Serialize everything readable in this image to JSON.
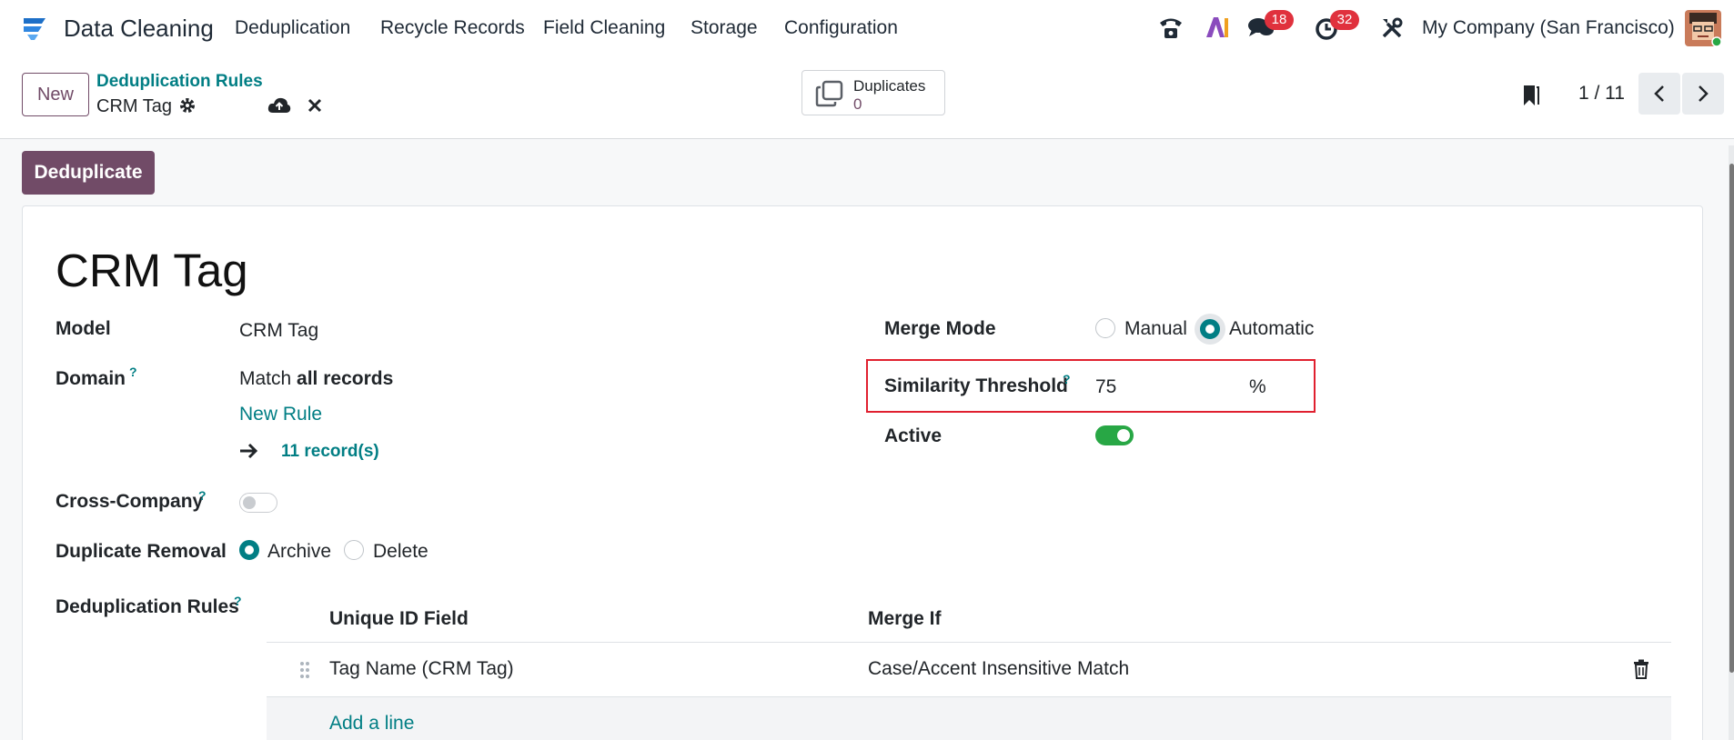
{
  "app": {
    "title": "Data Cleaning",
    "menu": [
      "Deduplication",
      "Recycle Records",
      "Field Cleaning",
      "Storage",
      "Configuration"
    ],
    "messages_count": "18",
    "activities_count": "32",
    "company": "My Company (San Francisco)"
  },
  "control_panel": {
    "new_label": "New",
    "breadcrumb_parent": "Deduplication Rules",
    "breadcrumb_current": "CRM Tag",
    "duplicates_label": "Duplicates",
    "duplicates_count": "0",
    "pager": "1 / 11"
  },
  "form": {
    "action_button": "Deduplicate",
    "record_title": "CRM Tag",
    "model_label": "Model",
    "model_value": "CRM Tag",
    "domain_label": "Domain",
    "domain_help": "?",
    "domain_prefix": "Match",
    "domain_bold": "all records",
    "new_rule": "New Rule",
    "record_count": "11 record(s)",
    "cross_company_label": "Cross-Company",
    "cross_company_help": "?",
    "cross_company_on": false,
    "removal_label": "Duplicate Removal",
    "removal_options": [
      "Archive",
      "Delete"
    ],
    "removal_selected": "Archive",
    "merge_mode_label": "Merge Mode",
    "merge_options": [
      "Manual",
      "Automatic"
    ],
    "merge_selected": "Automatic",
    "threshold_label": "Similarity Threshold",
    "threshold_help": "?",
    "threshold_value": "75",
    "threshold_unit": "%",
    "active_label": "Active",
    "active_on": true,
    "rules_label": "Deduplication Rules",
    "rules_help": "?",
    "rules_columns": [
      "Unique ID Field",
      "Merge If"
    ],
    "rules_rows": [
      {
        "field": "Tag Name (CRM Tag)",
        "merge_if": "Case/Accent Insensitive Match"
      }
    ],
    "add_line": "Add a line"
  },
  "colors": {
    "primary": "#714b67",
    "accent": "#017e84",
    "badge": "#e0313d",
    "toggle_on": "#28a745",
    "highlight": "#e0202f"
  }
}
